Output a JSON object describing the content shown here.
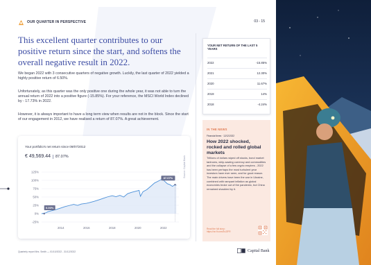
{
  "header": {
    "section_label": "OUR QUARTER IN PERSPECTIVE",
    "page_number": "03 - 15"
  },
  "headline": "This excellent quarter contributes to our positive return since the start, and softens the overall negative result in 2022.",
  "paragraphs": [
    "We began 2022 with 3 consecutive quarters of negative growth. Luckily, the last quarter of 2022 yielded a highly positive return of 6.50%.",
    "Unfortunately, as this quarter was the only positive one during the whole year, it was not able to turn the annual return of 2022 into a positive figure (-15.85%). For your reference, the MSCI World Index declined by - 17.73% in 2022.",
    "However, it is always important to have a long term view when results are not in the block. Since the start of our engagement in 2012, we have realised a return of 87.07%. A great achievement."
  ],
  "chart_card": {
    "title": "Your portfolio's net return since 09/07/2012",
    "value": "€ 49,569.44",
    "percent": "87.07%",
    "source_label": "Source: Capital Bank"
  },
  "chart_data": {
    "type": "area",
    "title": "Your portfolio's net return since 09/07/2012",
    "xlabel": "",
    "ylabel": "",
    "x_ticks": [
      "2014",
      "2016",
      "2018",
      "2020",
      "2022"
    ],
    "y_ticks": [
      "125%",
      "100%",
      "75%",
      "50%",
      "25%",
      "0%",
      "-25%"
    ],
    "ylim": [
      -25,
      125
    ],
    "xlim": [
      2012.5,
      2023.2
    ],
    "annotations": [
      {
        "label": "0.00%",
        "x": 2012.7,
        "y": 0
      },
      {
        "label": "87.07%",
        "x": 2022.9,
        "y": 87.07
      }
    ],
    "series": [
      {
        "x": [
          2012.5,
          2012.8,
          2013.0,
          2013.3,
          2013.6,
          2014.0,
          2014.3,
          2014.6,
          2015.0,
          2015.3,
          2015.6,
          2016.0,
          2016.3,
          2016.6,
          2017.0,
          2017.3,
          2017.6,
          2018.0,
          2018.3,
          2018.6,
          2018.9,
          2019.2,
          2019.5,
          2019.8,
          2020.1,
          2020.2,
          2020.4,
          2020.7,
          2021.0,
          2021.3,
          2021.6,
          2021.9,
          2022.1,
          2022.3,
          2022.5,
          2022.7,
          2022.9,
          2023.0
        ],
        "values": [
          0,
          2,
          6,
          9,
          12,
          17,
          21,
          24,
          28,
          25,
          29,
          31,
          34,
          37,
          42,
          46,
          50,
          54,
          51,
          55,
          50,
          60,
          64,
          67,
          70,
          52,
          66,
          72,
          82,
          92,
          98,
          104,
          97,
          90,
          87,
          82,
          87.07,
          85
        ]
      }
    ]
  },
  "returns_table": {
    "title": "YOUR NET RETURN OF THE LAST 5 YEARS",
    "rows": [
      {
        "year": "2022",
        "value": "-15.85%"
      },
      {
        "year": "2021",
        "value": "12.30%"
      },
      {
        "year": "2020",
        "value": "11.67%"
      },
      {
        "year": "2019",
        "value": "14%"
      },
      {
        "year": "2018",
        "value": "-4.24%"
      }
    ]
  },
  "news": {
    "label": "IN THE NEWS",
    "meta": "Financial times · 12/12/2022",
    "title": "How 2022 shocked, rocked and rolled global markets",
    "body": "Trillions of dollars wiped off stocks, bond market tantrums, whip-sawing currency and commodities and the collapse of a few crypto empires - 2022 has been perhaps the most turbulent year investors have ever seen, and for good reason. The main drivers have been the war in Ukraine, combined with rampant inflation as global economies broke out of the pandemic, but China remained shackled by it.",
    "link": "Read the full story: https://on.ft.com/3xJ2FR"
  },
  "footer": {
    "report_label": "Quarterly report Mrs. Smith  —  01/10/2022 - 31/12/2022",
    "brand": "Capital Bank"
  },
  "colors": {
    "accent_blue": "#3b4ba3",
    "chart_line": "#4a8fd8",
    "news_accent": "#e07b53",
    "news_bg": "#fbe9e1"
  }
}
